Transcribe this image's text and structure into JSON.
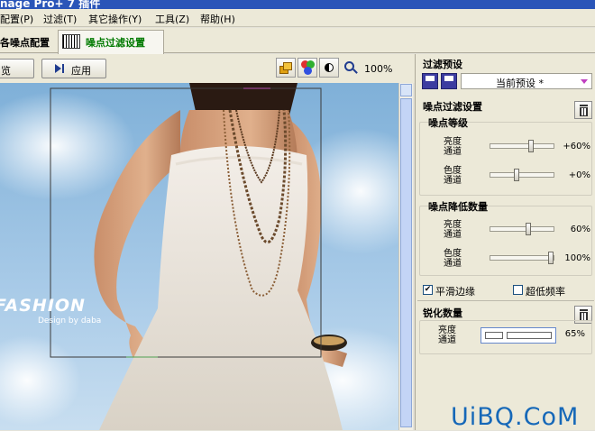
{
  "window": {
    "title": "nage Pro+ 7 插件"
  },
  "menu": [
    {
      "label": "配置(P)"
    },
    {
      "label": "过滤(T)"
    },
    {
      "label": "其它操作(Y)"
    },
    {
      "label": "工具(Z)"
    },
    {
      "label": "帮助(H)"
    }
  ],
  "tabs": {
    "tab1": "各噪点配置",
    "tab2": "噪点过滤设置"
  },
  "toolbar": {
    "preview_label": "览",
    "apply_label": "应用",
    "zoom": "100%"
  },
  "photo": {
    "brand": "FASHION",
    "byline": "Design by daba"
  },
  "panel": {
    "preset_title": "过滤预设",
    "preset_select": "当前预设 *",
    "noise_title": "噪点过滤设置",
    "level_title": "噪点等级",
    "level_rows": [
      {
        "label": "亮度\n通道",
        "value": "+60%",
        "fraction": 0.65
      },
      {
        "label": "色度\n通道",
        "value": "+0%",
        "fraction": 0.4
      }
    ],
    "reduce_title": "噪点降低数量",
    "reduce_rows": [
      {
        "label": "亮度\n通道",
        "value": "60%",
        "fraction": 0.6
      },
      {
        "label": "色度\n通道",
        "value": "100%",
        "fraction": 1.0
      }
    ],
    "smooth_label": "平滑边缘",
    "smooth_checked": "✔",
    "ultralow_label": "超低频率",
    "sharpen_title": "锐化数量",
    "sharpen_row": {
      "label": "亮度\n通道",
      "value": "65%"
    }
  },
  "watermark": "UiBQ.CoM",
  "colors": {
    "tab_active": "#007a00",
    "title_bar": "#2a55b8",
    "watermark": "#1668b8"
  }
}
